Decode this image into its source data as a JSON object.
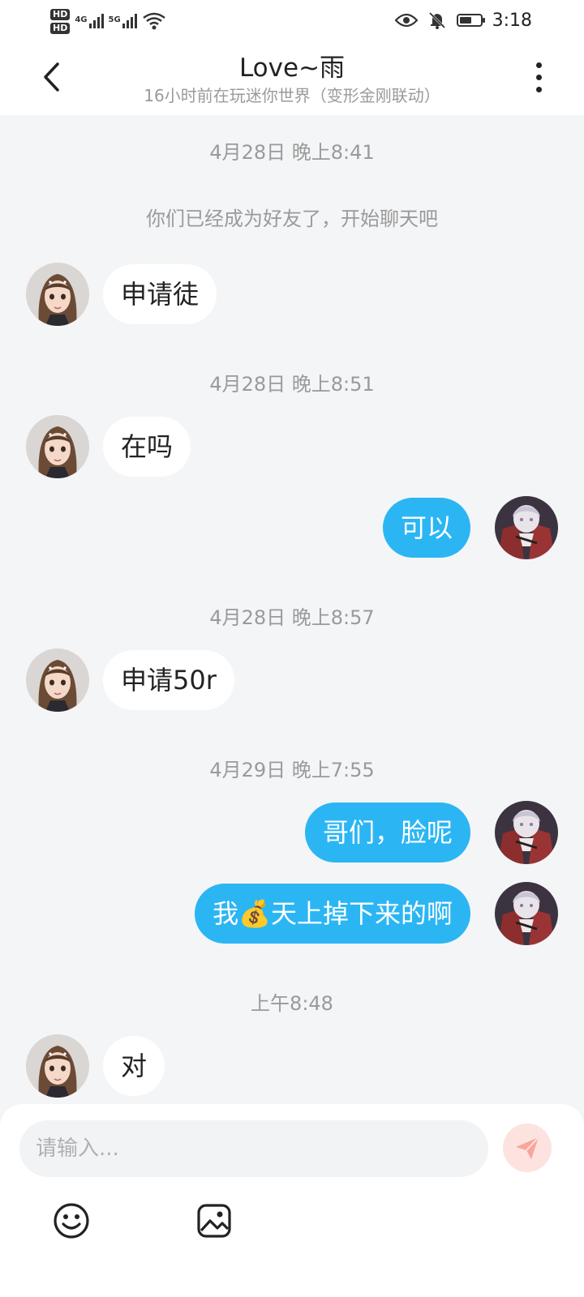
{
  "status_bar": {
    "hd1": "HD",
    "hd2": "HD",
    "net1": "4G",
    "net2": "5G",
    "time": "3:18",
    "battery_level": 0.6
  },
  "header": {
    "title": "Love~雨",
    "subtitle": "16小时前在玩迷你世界（变形金刚联动）"
  },
  "chat": {
    "timestamps": [
      "4月28日 晚上8:41",
      "4月28日 晚上8:51",
      "4月28日 晚上8:57",
      "4月29日 晚上7:55",
      "上午8:48"
    ],
    "system_message": "你们已经成为好友了，开始聊天吧",
    "messages": [
      {
        "from": "them",
        "text": "申请徒"
      },
      {
        "from": "them",
        "text": "在吗"
      },
      {
        "from": "me",
        "text": "可以"
      },
      {
        "from": "them",
        "text": "申请50r"
      },
      {
        "from": "me",
        "text": "哥们，脸呢"
      },
      {
        "from": "me",
        "text": "我💰天上掉下来的啊"
      },
      {
        "from": "them",
        "text": "对"
      }
    ]
  },
  "composer": {
    "placeholder": "请输入...",
    "send_icon": "send-icon",
    "emoji_icon": "emoji-icon",
    "image_icon": "image-icon"
  },
  "colors": {
    "outgoing_bubble": "#2bb6f3",
    "incoming_bubble": "#ffffff",
    "background": "#f4f5f7",
    "send_button": "#fde3e0",
    "send_icon": "#f7a69c"
  }
}
